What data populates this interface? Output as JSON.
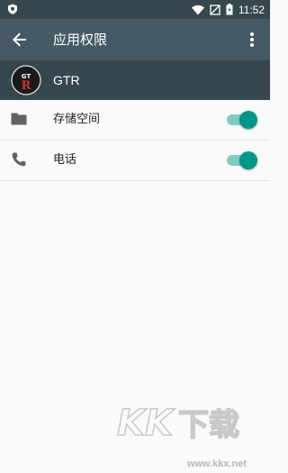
{
  "status_bar": {
    "time": "11:52",
    "icons": [
      "shield-icon",
      "wifi-icon",
      "no-sim-icon",
      "battery-icon"
    ]
  },
  "app_bar": {
    "title": "应用权限",
    "back_icon": "arrow-back-icon",
    "menu_icon": "more-vert-icon"
  },
  "app": {
    "name": "GTR",
    "logo_text": "GTR"
  },
  "permissions": [
    {
      "label": "存储空间",
      "icon": "folder-icon",
      "enabled": true
    },
    {
      "label": "电话",
      "icon": "phone-icon",
      "enabled": true
    }
  ],
  "watermark": {
    "logo_text": "KK下载",
    "url": "www.kkx.net"
  },
  "colors": {
    "status_bar": "#37474f",
    "app_bar": "#455a64",
    "app_row": "#37474f",
    "accent": "#009688",
    "accent_track": "#80cbc4",
    "background": "#fafafa"
  }
}
